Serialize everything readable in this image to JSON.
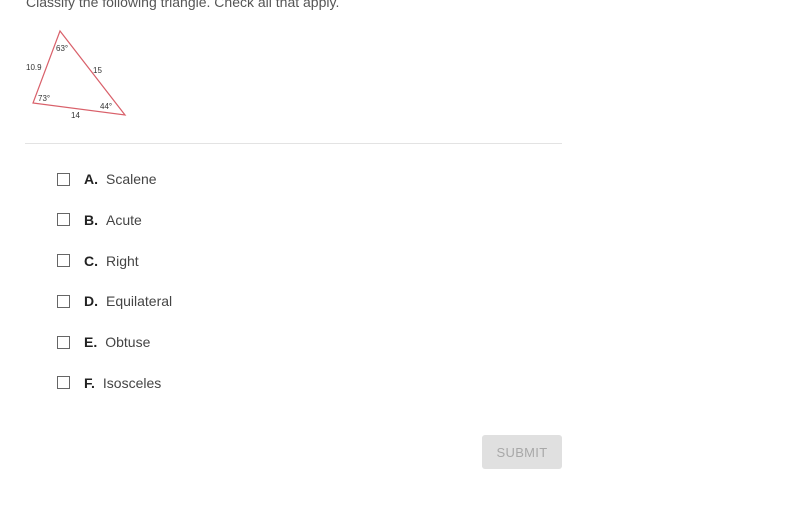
{
  "question": {
    "prompt": "Classify the following triangle. Check all that apply."
  },
  "figure": {
    "stroke_color": "#d9606a",
    "sides": {
      "left": "10.9",
      "right": "15",
      "bottom": "14"
    },
    "angles": {
      "top": "63°",
      "bottom_left": "73°",
      "bottom_right": "44°"
    }
  },
  "options": [
    {
      "letter": "A.",
      "label": "Scalene",
      "checked": false
    },
    {
      "letter": "B.",
      "label": "Acute",
      "checked": false
    },
    {
      "letter": "C.",
      "label": "Right",
      "checked": false
    },
    {
      "letter": "D.",
      "label": "Equilateral",
      "checked": false
    },
    {
      "letter": "E.",
      "label": "Obtuse",
      "checked": false
    },
    {
      "letter": "F.",
      "label": "Isosceles",
      "checked": false
    }
  ],
  "submit": {
    "label": "SUBMIT",
    "enabled": false
  }
}
